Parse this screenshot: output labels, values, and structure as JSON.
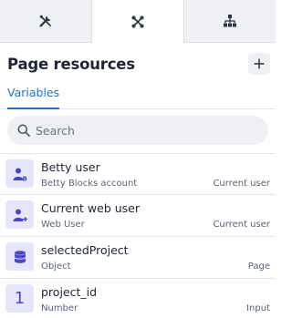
{
  "tabs": [
    {
      "icon": "tools-icon",
      "active": false
    },
    {
      "icon": "nodes-icon",
      "active": true
    },
    {
      "icon": "hierarchy-icon",
      "active": false
    }
  ],
  "header": {
    "title": "Page resources",
    "add_icon": "plus-icon"
  },
  "subtabs": {
    "variables_label": "Variables"
  },
  "search": {
    "placeholder": "Search",
    "value": ""
  },
  "items": [
    {
      "name": "Betty user",
      "type": "Betty Blocks account",
      "scope": "Current user",
      "icon": "user-badge-icon"
    },
    {
      "name": "Current web user",
      "type": "Web User",
      "scope": "Current user",
      "icon": "user-swap-icon"
    },
    {
      "name": "selectedProject",
      "type": "Object",
      "scope": "Page",
      "icon": "database-icon"
    },
    {
      "name": "project_id",
      "type": "Number",
      "scope": "Input",
      "icon": "number-icon",
      "glyph": "1"
    }
  ],
  "colors": {
    "accent": "#1976d2",
    "icon_bg": "#e6e6fb",
    "icon_fg": "#4b45c8"
  }
}
